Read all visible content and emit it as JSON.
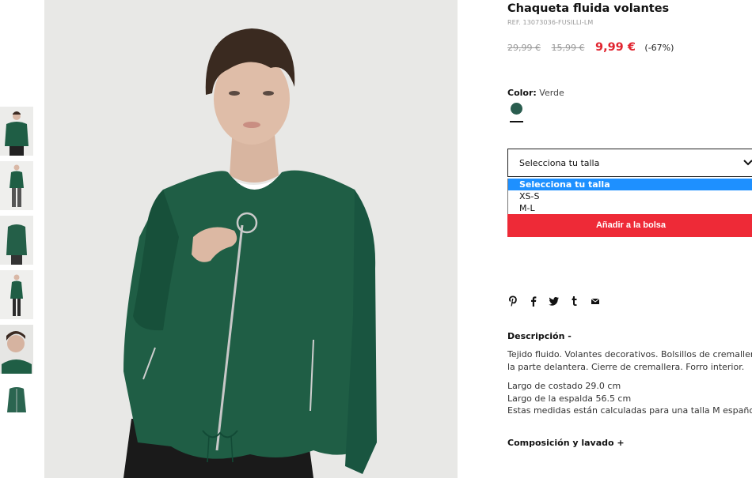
{
  "product": {
    "title": "Chaqueta fluida volantes",
    "ref": "REF. 13073036-FUSILLI-LM",
    "price_original": "29,99 €",
    "price_previous": "15,99 €",
    "price_current": "9,99 €",
    "discount": "(-67%)"
  },
  "color": {
    "label": "Color:",
    "value": "Verde",
    "swatch_hex": "#2a5d4f"
  },
  "size": {
    "placeholder": "Selecciona tu talla",
    "options": [
      "Selecciona tu talla",
      "XS-S",
      "M-L"
    ],
    "selected_index": 0
  },
  "add_to_bag": "Añadir a la bolsa",
  "share_icons": [
    "pinterest-icon",
    "facebook-icon",
    "twitter-icon",
    "tumblr-icon",
    "email-icon"
  ],
  "description": {
    "heading": "Descripción -",
    "line1": "Tejido fluido. Volantes decorativos. Bolsillos de cremallera en",
    "line2": "la parte delantera. Cierre de cremallera. Forro interior.",
    "measure1": "Largo de costado 29.0 cm",
    "measure2": "Largo de la espalda 56.5 cm",
    "measure3": "Estas medidas están calculadas para una talla M española."
  },
  "composition_heading": "Composición y lavado +",
  "colors": {
    "accent_red": "#ee2a37",
    "price_red": "#e1242f",
    "jacket_green": "#1f5e45"
  }
}
